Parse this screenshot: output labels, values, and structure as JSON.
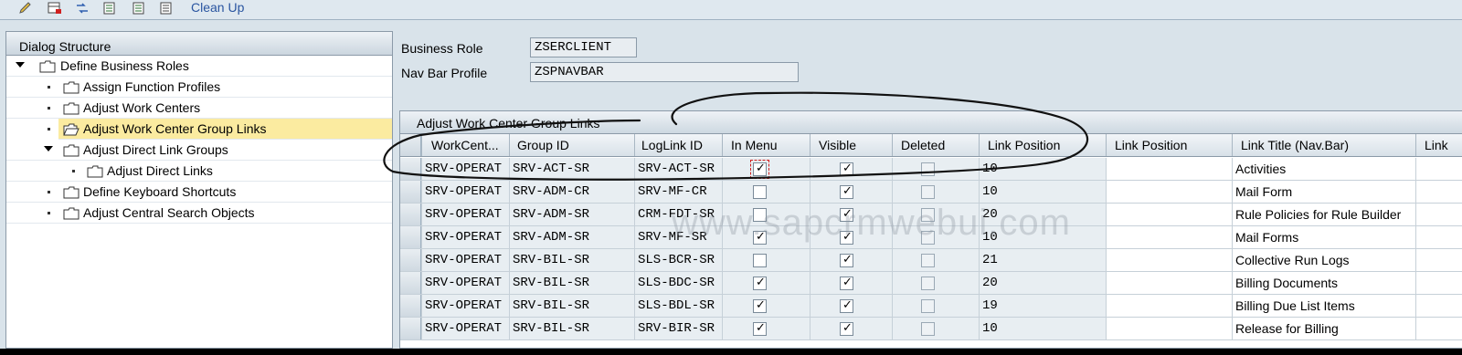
{
  "toolbar": {
    "icons": [
      "pencil-icon",
      "table-add-icon",
      "exchange-icon",
      "document-icon",
      "document-icon",
      "document-icon"
    ],
    "clean_up_label": "Clean Up"
  },
  "dialog_structure": {
    "title": "Dialog Structure",
    "items": [
      {
        "label": "Define Business Roles",
        "expanded": true
      },
      {
        "label": "Assign Function Profiles"
      },
      {
        "label": "Adjust Work Centers"
      },
      {
        "label": "Adjust Work Center Group Links",
        "selected": true
      },
      {
        "label": "Adjust Direct Link Groups",
        "expanded": true
      },
      {
        "label": "Adjust Direct Links"
      },
      {
        "label": "Define Keyboard Shortcuts"
      },
      {
        "label": "Adjust Central Search Objects"
      }
    ]
  },
  "header": {
    "business_role_label": "Business Role",
    "business_role_value": "ZSERCLIENT",
    "nav_bar_profile_label": "Nav Bar Profile",
    "nav_bar_profile_value": "ZSPNAVBAR"
  },
  "table": {
    "title": "Adjust Work Center Group Links",
    "columns": [
      "WorkCent...",
      "Group ID",
      "LogLink ID",
      "In Menu",
      "Visible",
      "Deleted",
      "Link Position",
      "Link Position",
      "Link Title (Nav.Bar)",
      "Link"
    ],
    "rows": [
      {
        "workcenter": "SRV-OPERAT",
        "group_id": "SRV-ACT-SR",
        "loglink_id": "SRV-ACT-SR",
        "in_menu": true,
        "visible": true,
        "deleted": false,
        "link_position": "10",
        "link_position2": "",
        "link_title": "Activities"
      },
      {
        "workcenter": "SRV-OPERAT",
        "group_id": "SRV-ADM-CR",
        "loglink_id": "SRV-MF-CR",
        "in_menu": false,
        "visible": true,
        "deleted": false,
        "link_position": "10",
        "link_position2": "",
        "link_title": "Mail Form"
      },
      {
        "workcenter": "SRV-OPERAT",
        "group_id": "SRV-ADM-SR",
        "loglink_id": "CRM-FDT-SR",
        "in_menu": false,
        "visible": true,
        "deleted": false,
        "link_position": "20",
        "link_position2": "",
        "link_title": "Rule Policies for Rule Builder"
      },
      {
        "workcenter": "SRV-OPERAT",
        "group_id": "SRV-ADM-SR",
        "loglink_id": "SRV-MF-SR",
        "in_menu": true,
        "visible": true,
        "deleted": false,
        "link_position": "10",
        "link_position2": "",
        "link_title": "Mail Forms"
      },
      {
        "workcenter": "SRV-OPERAT",
        "group_id": "SRV-BIL-SR",
        "loglink_id": "SLS-BCR-SR",
        "in_menu": false,
        "visible": true,
        "deleted": false,
        "link_position": "21",
        "link_position2": "",
        "link_title": "Collective Run Logs"
      },
      {
        "workcenter": "SRV-OPERAT",
        "group_id": "SRV-BIL-SR",
        "loglink_id": "SLS-BDC-SR",
        "in_menu": true,
        "visible": true,
        "deleted": false,
        "link_position": "20",
        "link_position2": "",
        "link_title": "Billing Documents"
      },
      {
        "workcenter": "SRV-OPERAT",
        "group_id": "SRV-BIL-SR",
        "loglink_id": "SLS-BDL-SR",
        "in_menu": true,
        "visible": true,
        "deleted": false,
        "link_position": "19",
        "link_position2": "",
        "link_title": "Billing Due List Items"
      },
      {
        "workcenter": "SRV-OPERAT",
        "group_id": "SRV-BIL-SR",
        "loglink_id": "SRV-BIR-SR",
        "in_menu": true,
        "visible": true,
        "deleted": false,
        "link_position": "10",
        "link_position2": "",
        "link_title": "Release for Billing"
      }
    ]
  },
  "watermark": "www.sapcrmwebui.com"
}
